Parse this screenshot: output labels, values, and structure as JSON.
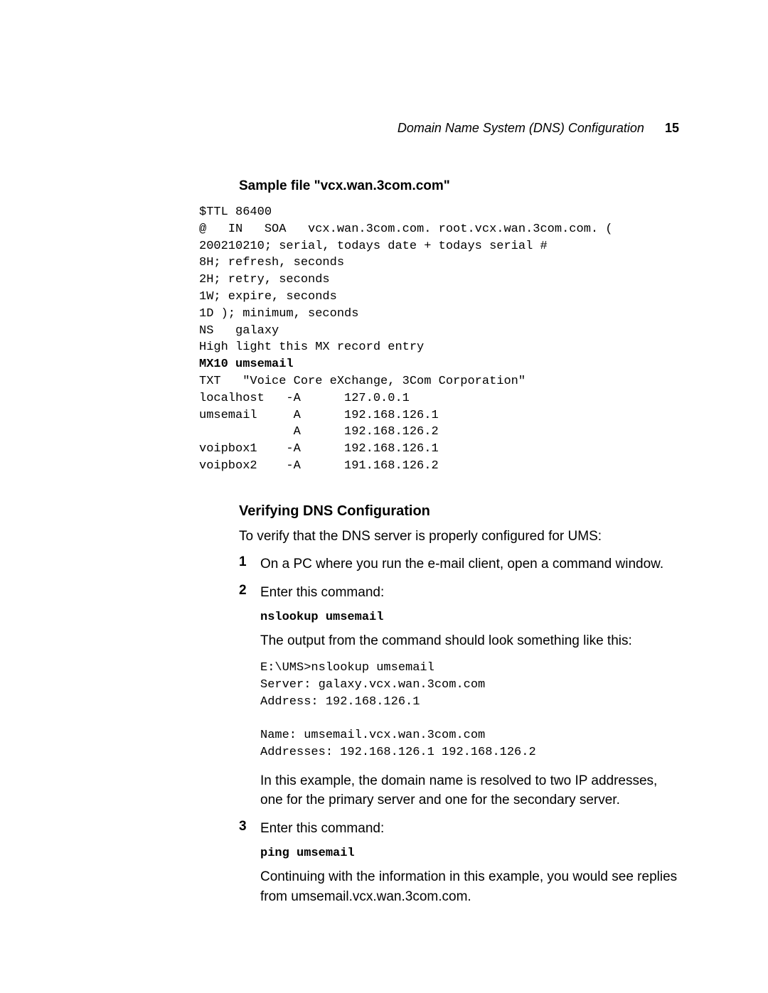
{
  "header": {
    "running_title": "Domain Name System (DNS) Configuration",
    "page_number": "15"
  },
  "sample_file": {
    "title": "Sample file \"vcx.wan.3com.com\"",
    "pre1": "$TTL 86400\n@   IN   SOA   vcx.wan.3com.com. root.vcx.wan.3com.com. (\n200210210; serial, todays date + todays serial #\n8H; refresh, seconds\n2H; retry, seconds\n1W; expire, seconds\n1D ); minimum, seconds\nNS   galaxy\nHigh light this MX record entry",
    "bold_line": "MX10 umsemail",
    "pre2": "TXT   \"Voice Core eXchange, 3Com Corporation\"\nlocalhost   -A      127.0.0.1\numsemail     A      192.168.126.1\n             A      192.168.126.2\nvoipbox1    -A      192.168.126.1\nvoipbox2    -A      191.168.126.2"
  },
  "verify": {
    "heading": "Verifying DNS Configuration",
    "intro": "To verify that the DNS server is properly configured for UMS:",
    "step1": {
      "num": "1",
      "text": "On a PC where you run the e-mail client, open a command window."
    },
    "step2": {
      "num": "2",
      "text": "Enter this command:",
      "cmd": "nslookup umsemail",
      "after": "The output from the command should look something like this:",
      "output": "E:\\UMS>nslookup umsemail\nServer: galaxy.vcx.wan.3com.com\nAddress: 192.168.126.1\n\nName: umsemail.vcx.wan.3com.com\nAddresses: 192.168.126.1 192.168.126.2",
      "explain": "In this example, the domain name is resolved to two IP addresses, one for the primary server and one for the secondary server."
    },
    "step3": {
      "num": "3",
      "text": "Enter this command:",
      "cmd": "ping umsemail",
      "after": "Continuing with the information in this example, you would see replies from umsemail.vcx.wan.3com.com."
    }
  }
}
